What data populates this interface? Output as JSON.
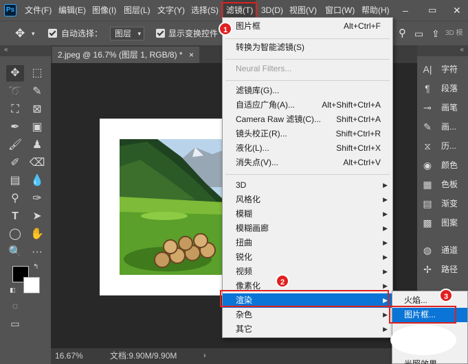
{
  "app": {
    "logo": "Ps"
  },
  "menubar": {
    "items": [
      {
        "label": "文件(F)"
      },
      {
        "label": "编辑(E)"
      },
      {
        "label": "图像(I)"
      },
      {
        "label": "图层(L)"
      },
      {
        "label": "文字(Y)"
      },
      {
        "label": "选择(S)"
      },
      {
        "label": "滤镜(T)"
      },
      {
        "label": "3D(D)"
      },
      {
        "label": "视图(V)"
      },
      {
        "label": "窗口(W)"
      },
      {
        "label": "帮助(H)"
      }
    ],
    "active": "滤镜(T)"
  },
  "options_bar": {
    "auto_select_label": "自动选择：",
    "auto_select_value": "图层",
    "show_transform_label": "显示变换控件",
    "mode_3d_label": "3D 模"
  },
  "document": {
    "tab_title": "2.jpeg @ 16.7% (图层 1, RGB/8) *",
    "tab_close": "×",
    "zoom": "16.67%",
    "doc_size": "文档:9.90M/9.90M"
  },
  "right_panels": [
    {
      "icon": "character-icon",
      "glyph": "A|",
      "label": "字符"
    },
    {
      "icon": "paragraph-icon",
      "glyph": "¶",
      "label": "段落"
    },
    {
      "icon": "brush-settings-icon",
      "glyph": "⊸",
      "label": "画笔"
    },
    {
      "icon": "brush-icon",
      "glyph": "✎",
      "label": "画..."
    },
    {
      "icon": "history-icon",
      "glyph": "⧖",
      "label": "历..."
    },
    {
      "icon": "color-icon",
      "glyph": "◉",
      "label": "颜色"
    },
    {
      "icon": "swatches-icon",
      "glyph": "▦",
      "label": "色板"
    },
    {
      "icon": "gradient-icon",
      "glyph": "▤",
      "label": "渐变"
    },
    {
      "icon": "patterns-icon",
      "glyph": "▩",
      "label": "图案"
    },
    {
      "icon": "channels-icon",
      "glyph": "◍",
      "label": "通道"
    },
    {
      "icon": "paths-icon",
      "glyph": "✢",
      "label": "路径"
    }
  ],
  "filter_menu": {
    "items": [
      {
        "label": "图片框",
        "shortcut": "Alt+Ctrl+F"
      },
      {
        "label": "转换为智能滤镜(S)",
        "shortcut": ""
      },
      {
        "label": "Neural Filters...",
        "shortcut": "",
        "disabled": true
      },
      {
        "label": "滤镜库(G)...",
        "shortcut": ""
      },
      {
        "label": "自适应广角(A)...",
        "shortcut": "Alt+Shift+Ctrl+A"
      },
      {
        "label": "Camera Raw 滤镜(C)...",
        "shortcut": "Shift+Ctrl+A"
      },
      {
        "label": "镜头校正(R)...",
        "shortcut": "Shift+Ctrl+R"
      },
      {
        "label": "液化(L)...",
        "shortcut": "Shift+Ctrl+X"
      },
      {
        "label": "消失点(V)...",
        "shortcut": "Alt+Ctrl+V"
      },
      {
        "label": "3D",
        "submenu": true
      },
      {
        "label": "风格化",
        "submenu": true
      },
      {
        "label": "模糊",
        "submenu": true
      },
      {
        "label": "模糊画廊",
        "submenu": true
      },
      {
        "label": "扭曲",
        "submenu": true
      },
      {
        "label": "锐化",
        "submenu": true
      },
      {
        "label": "视频",
        "submenu": true
      },
      {
        "label": "像素化",
        "submenu": true
      },
      {
        "label": "渲染",
        "submenu": true,
        "selected": true
      },
      {
        "label": "杂色",
        "submenu": true
      },
      {
        "label": "其它",
        "submenu": true
      }
    ]
  },
  "render_submenu": {
    "items": [
      {
        "label": "火焰..."
      },
      {
        "label": "图片框...",
        "selected": true
      },
      {
        "label": "光照效果..."
      }
    ]
  },
  "annotations": [
    {
      "number": "1",
      "color": "#e02020"
    },
    {
      "number": "2",
      "color": "#e02020"
    },
    {
      "number": "3",
      "color": "#e02020"
    }
  ],
  "colors": {
    "menubar_bg": "#535353",
    "canvas_bg": "#282828",
    "menu_bg": "#f0f0f0",
    "highlight": "#0a75d6",
    "annotation": "#e02020"
  }
}
